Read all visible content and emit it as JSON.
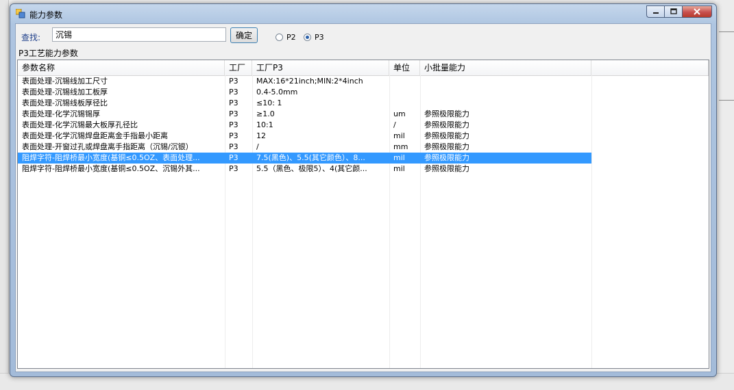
{
  "window": {
    "title": "能力参数"
  },
  "search": {
    "label": "查找:",
    "value": "沉锡",
    "button_label": "确定"
  },
  "radios": [
    {
      "label": "P2",
      "checked": false
    },
    {
      "label": "P3",
      "checked": true
    }
  ],
  "section_label": "P3工艺能力参数",
  "table": {
    "columns": [
      "参数名称",
      "工厂",
      "工厂P3",
      "单位",
      "小批量能力"
    ],
    "rows": [
      {
        "name": "表面处理-沉锡线加工尺寸",
        "factory": "P3",
        "p3": "MAX:16*21inch;MIN:2*4inch",
        "unit": "",
        "small": ""
      },
      {
        "name": "表面处理-沉锡线加工板厚",
        "factory": "P3",
        "p3": "0.4-5.0mm",
        "unit": "",
        "small": ""
      },
      {
        "name": "表面处理-沉锡线板厚径比",
        "factory": "P3",
        "p3": "≤10: 1",
        "unit": "",
        "small": ""
      },
      {
        "name": "表面处理-化学沉锡锡厚",
        "factory": "P3",
        "p3": "≥1.0",
        "unit": "um",
        "small": "参照极限能力"
      },
      {
        "name": "表面处理-化学沉锡最大板厚孔径比",
        "factory": "P3",
        "p3": "10:1",
        "unit": "/",
        "small": "参照极限能力"
      },
      {
        "name": "表面处理-化学沉锡焊盘距离金手指最小距离",
        "factory": "P3",
        "p3": "12",
        "unit": "mil",
        "small": "参照极限能力"
      },
      {
        "name": "表面处理-开窗过孔或焊盘离手指距离（沉锡/沉银）",
        "factory": "P3",
        "p3": "/",
        "unit": "mm",
        "small": "参照极限能力"
      },
      {
        "name": "阻焊字符-阻焊桥最小宽度(基铜≤0.5OZ、表面处理...",
        "factory": "P3",
        "p3": "7.5(黑色)、5.5(其它颜色）、8...",
        "unit": "mil",
        "small": "参照极限能力",
        "selected": true
      },
      {
        "name": "阻焊字符-阻焊桥最小宽度(基铜≤0.5OZ、沉锡外其...",
        "factory": "P3",
        "p3": "5.5（黑色、极限5）、4(其它颜...",
        "unit": "mil",
        "small": "参照极限能力"
      }
    ]
  }
}
